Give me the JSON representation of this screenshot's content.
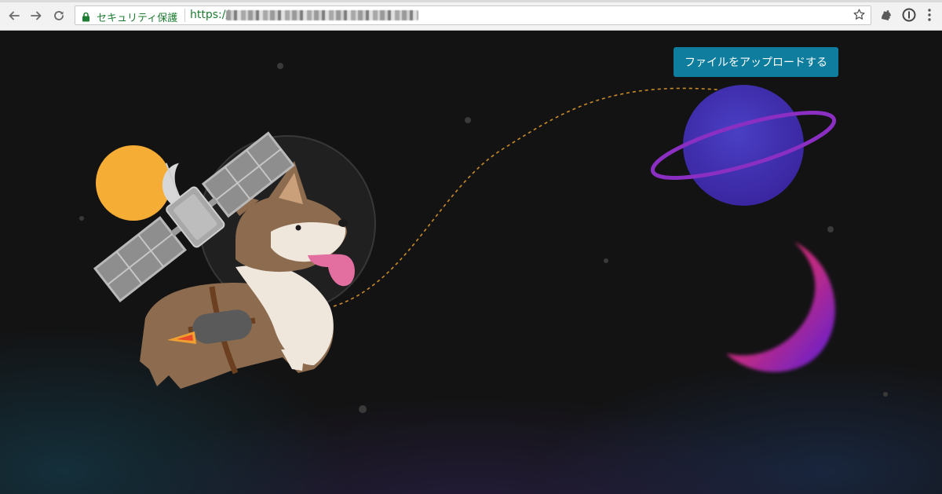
{
  "browser": {
    "security_label": "セキュリティ保護",
    "url_scheme": "https://",
    "url_rest": "",
    "icons": {
      "back": "back-arrow-icon",
      "forward": "forward-arrow-icon",
      "reload": "reload-icon",
      "lock": "lock-icon",
      "bookmark": "star-icon",
      "extension1": "extension-icon",
      "extension2": "info-circle-icon",
      "menu": "kebab-menu-icon"
    }
  },
  "page": {
    "upload_button_label": "ファイルをアップロードする",
    "accent_color": "#0e7d9e",
    "background_color": "#131314"
  }
}
